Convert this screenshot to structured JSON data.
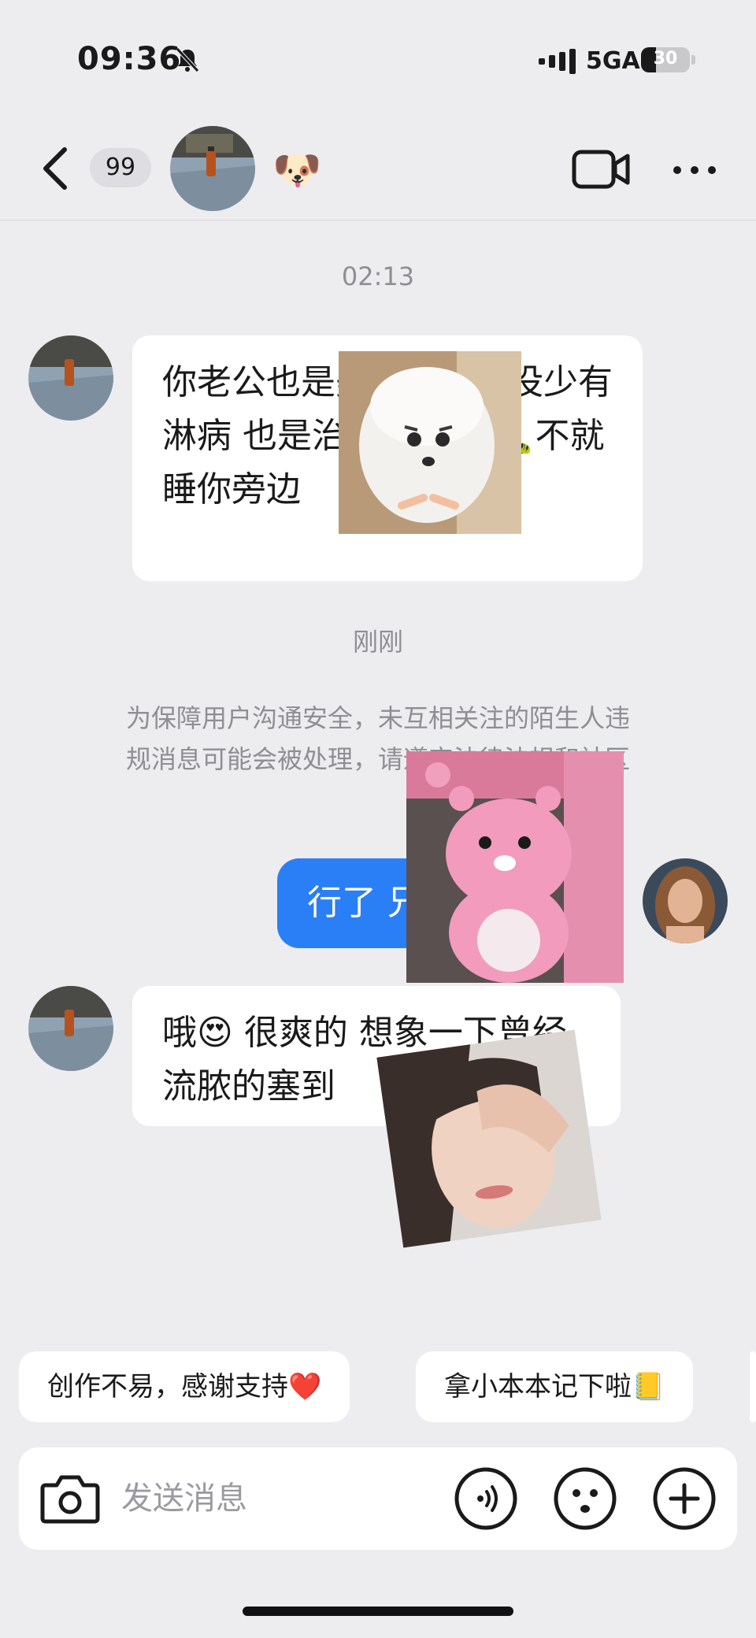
{
  "status_bar": {
    "time": "09:36",
    "network": "5GA",
    "battery_level": "30",
    "battery_fraction": 0.3,
    "icons": [
      "bell-muted-icon",
      "signal-icon",
      "battery-icon"
    ]
  },
  "header": {
    "unread_count": "99",
    "contact_emoji": "🐶",
    "icons": [
      "back-chevron-icon",
      "video-call-icon",
      "more-icon"
    ]
  },
  "chat": {
    "timestamp_1": "02:13",
    "message_1": "你老公也是美国留学也没少有淋病 也是治人是p🐛 🐛不就睡你旁边",
    "timestamp_2": "刚刚",
    "system_notice": "为保障用户沟通安全，未互相关注的陌生人违规消息可能会被处理，请遵守法律法规和社区",
    "my_message": "行了 兄",
    "message_2": "哦😍 很爽的 想象一下曾经流脓的塞到"
  },
  "quick_replies": [
    {
      "label": "创作不易，感谢支持❤️"
    },
    {
      "label": "拿小本本记下啦📒"
    }
  ],
  "input": {
    "placeholder": "发送消息",
    "icons": [
      "camera-icon",
      "voice-icon",
      "emoji-icon",
      "plus-icon"
    ]
  },
  "colors": {
    "background": "#ededf0",
    "my_bubble": "#2a7ff6",
    "other_bubble": "#ffffff",
    "muted_text": "#8e8e93"
  }
}
